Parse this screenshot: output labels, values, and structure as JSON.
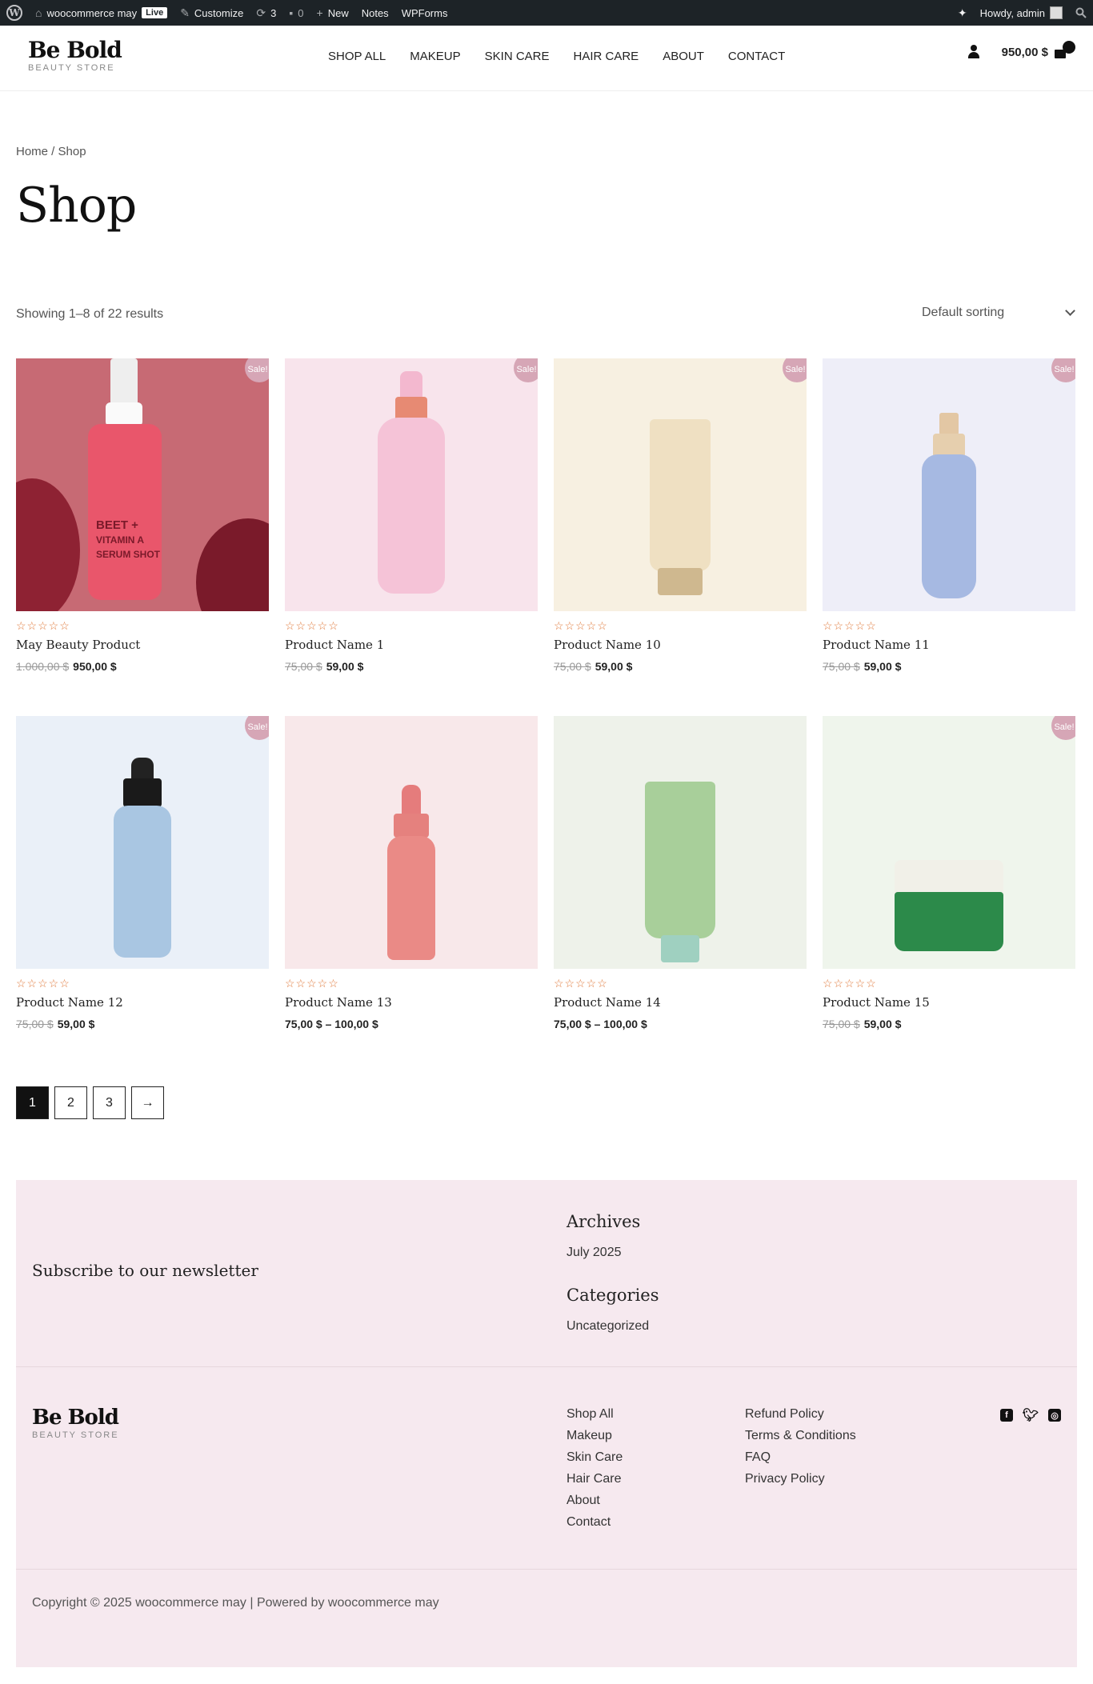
{
  "adminbar": {
    "site_name": "woocommerce may",
    "live": "Live",
    "customize": "Customize",
    "updates": "3",
    "comments": "0",
    "new": "New",
    "notes": "Notes",
    "wpforms": "WPForms",
    "howdy": "Howdy, admin"
  },
  "header": {
    "logo_main": "Be Bold",
    "logo_sub": "BEAUTY STORE",
    "nav": [
      "SHOP ALL",
      "MAKEUP",
      "SKIN CARE",
      "HAIR CARE",
      "ABOUT",
      "CONTACT"
    ],
    "cart_total": "950,00 $"
  },
  "page": {
    "breadcrumb": "Home / Shop",
    "title": "Shop",
    "result_count": "Showing 1–8 of 22 results",
    "sorting": "Default sorting"
  },
  "products": [
    {
      "name": "May Beauty Product",
      "old_price": "1.000,00 $",
      "price": "950,00 $",
      "sale": "Sale!",
      "bg": "#c76a74",
      "stars": "☆☆☆☆☆"
    },
    {
      "name": "Product Name 1",
      "old_price": "75,00 $",
      "price": "59,00 $",
      "sale": "Sale!",
      "bg": "#f8e4ec",
      "stars": "☆☆☆☆☆"
    },
    {
      "name": "Product Name 10",
      "old_price": "75,00 $",
      "price": "59,00 $",
      "sale": "Sale!",
      "bg": "#f7f0e1",
      "stars": "☆☆☆☆☆"
    },
    {
      "name": "Product Name 11",
      "old_price": "75,00 $",
      "price": "59,00 $",
      "sale": "Sale!",
      "bg": "#eeeef8",
      "stars": "☆☆☆☆☆"
    },
    {
      "name": "Product Name 12",
      "old_price": "75,00 $",
      "price": "59,00 $",
      "sale": "Sale!",
      "bg": "#eaf0f8",
      "stars": "☆☆☆☆☆"
    },
    {
      "name": "Product Name 13",
      "old_price": "",
      "price": "75,00 $ – 100,00 $",
      "sale": "",
      "bg": "#f8e8ea",
      "stars": "☆☆☆☆☆"
    },
    {
      "name": "Product Name 14",
      "old_price": "",
      "price": "75,00 $ – 100,00 $",
      "sale": "",
      "bg": "#eef2ea",
      "stars": "☆☆☆☆☆"
    },
    {
      "name": "Product Name 15",
      "old_price": "75,00 $",
      "price": "59,00 $",
      "sale": "Sale!",
      "bg": "#eff5ec",
      "stars": "☆☆☆☆☆"
    }
  ],
  "product_labels": {
    "beet_line1": "BEET +",
    "beet_line2": "VITAMIN A",
    "beet_line3": "SERUM SHOT"
  },
  "pagination": [
    "1",
    "2",
    "3",
    "→"
  ],
  "footer": {
    "subscribe": "Subscribe to our newsletter",
    "archives_title": "Archives",
    "archives_link": "July 2025",
    "categories_title": "Categories",
    "categories_link": "Uncategorized",
    "logo_main": "Be Bold",
    "logo_sub": "BEAUTY STORE",
    "col1": [
      "Shop All",
      "Makeup",
      "Skin Care",
      "Hair Care",
      "About",
      "Contact"
    ],
    "col2": [
      "Refund Policy",
      "Terms & Conditions",
      "FAQ",
      "Privacy Policy"
    ],
    "social_icons": [
      "facebook-icon",
      "twitter-icon",
      "instagram-icon"
    ],
    "copyright": "Copyright © 2025 woocommerce may | Powered by woocommerce may"
  },
  "colors": {
    "sale_badge": "#d6a6b6",
    "footer_bg": "#f6e9ef",
    "stars": "#e07a3c"
  }
}
